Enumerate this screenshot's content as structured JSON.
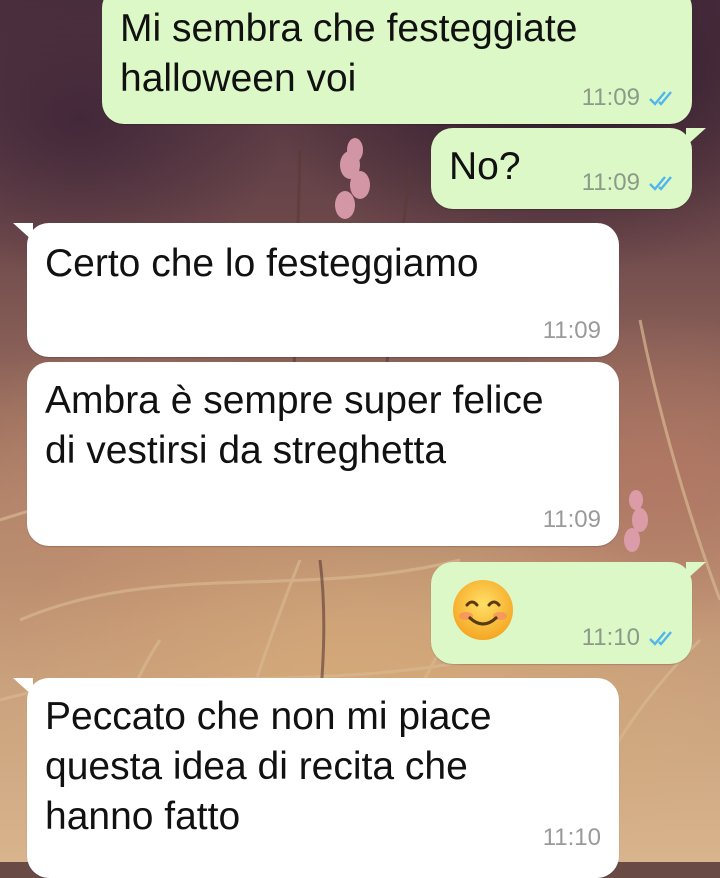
{
  "messages": [
    {
      "direction": "outgoing",
      "text": "Mi sembra che festeggiate\nhalloween voi",
      "time": "11:09",
      "status": "read-ticks-icon"
    },
    {
      "direction": "outgoing",
      "text": "No?",
      "time": "11:09",
      "status": "read-ticks-icon"
    },
    {
      "direction": "incoming",
      "text": "Certo che lo festeggiamo",
      "time": "11:09"
    },
    {
      "direction": "incoming",
      "text": "Ambra è sempre super felice\ndi vestirsi da streghetta",
      "time": "11:09"
    },
    {
      "direction": "outgoing",
      "emoji": "smiling-face-with-smiling-eyes-icon",
      "time": "11:10",
      "status": "read-ticks-icon"
    },
    {
      "direction": "incoming",
      "text": "Peccato che non mi piace\nquesta idea di recita che\nhanno fatto",
      "time": "11:10"
    }
  ],
  "colors": {
    "outgoing_bubble": "#dcf8c6",
    "incoming_bubble": "#ffffff",
    "read_ticks": "#4fb6ec",
    "timestamp": "#8c9a8a"
  }
}
